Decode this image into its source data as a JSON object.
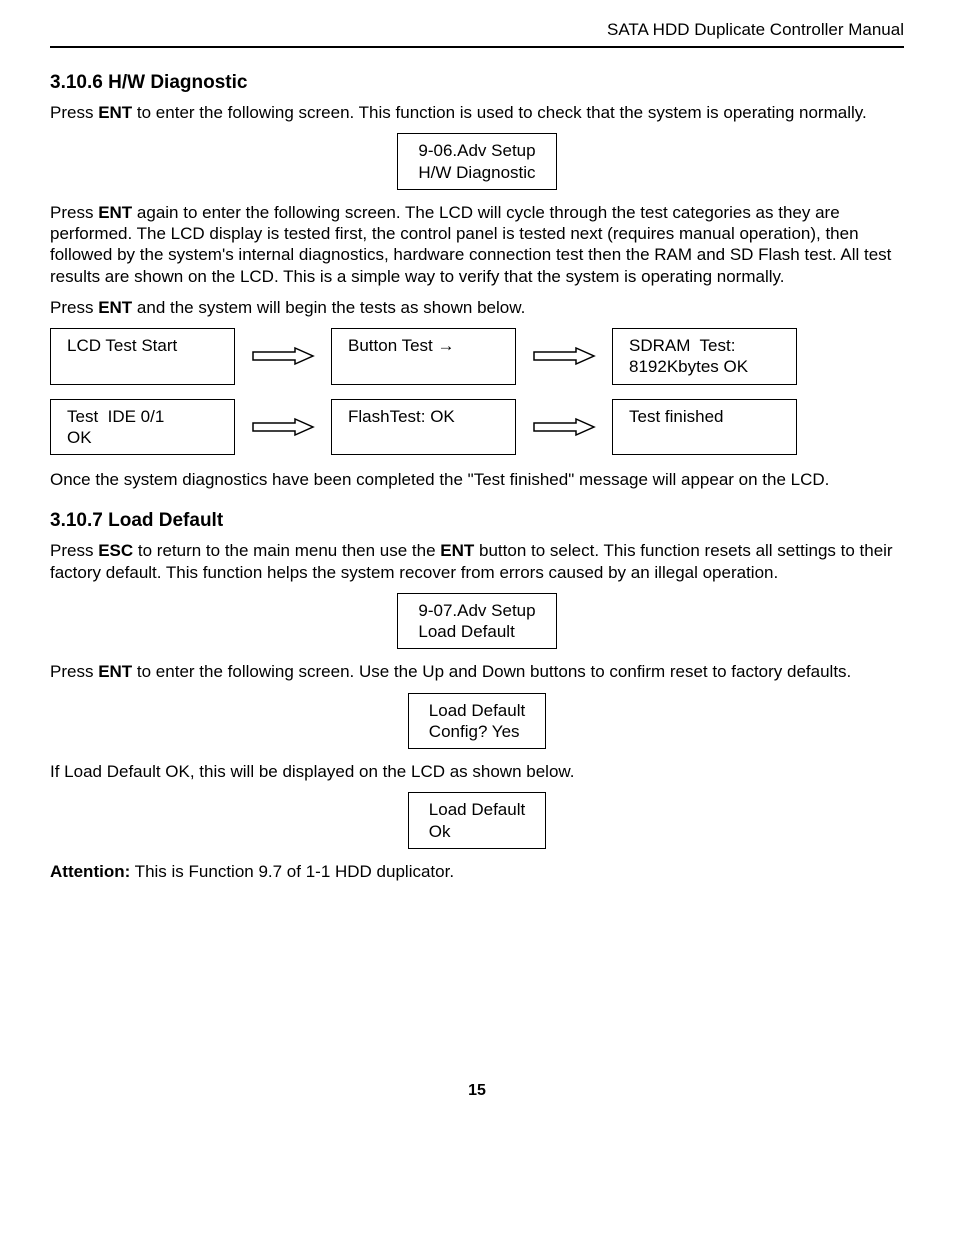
{
  "header": "SATA HDD Duplicate Controller Manual",
  "s1": {
    "heading": "3.10.6 H/W Diagnostic",
    "p1a": "Press ",
    "p1b": "ENT",
    "p1c": " to enter the following screen. This function is used to check that the system is operating normally.",
    "lcd1": {
      "l1": "9-06.Adv Setup",
      "l2": "H/W Diagnostic"
    },
    "p2a": "Press ",
    "p2b": "ENT",
    "p2c": " again to enter the following screen. The LCD will cycle through the test categories as they are performed. The LCD display is tested first, the control panel is tested next (requires manual operation), then followed by the system's internal diagnostics, hardware connection test then the RAM and SD Flash test. All test results are shown on the LCD. This is a simple way to verify that the system is operating normally.",
    "p3a": "Press ",
    "p3b": "ENT",
    "p3c": " and the system will begin the tests as shown below.",
    "flow": [
      {
        "l1": "LCD Test Start",
        "l2": ""
      },
      {
        "l1": "Button Test →",
        "l2": ""
      },
      {
        "l1": "SDRAM  Test:",
        "l2": "8192Kbytes OK"
      },
      {
        "l1": "Test  IDE 0/1",
        "l2": "OK"
      },
      {
        "l1": "FlashTest: OK",
        "l2": ""
      },
      {
        "l1": "Test finished",
        "l2": ""
      }
    ],
    "p4": "Once the system diagnostics have been completed the \"Test finished\" message will appear on the LCD."
  },
  "s2": {
    "heading": "3.10.7 Load Default",
    "p1a": "Press ",
    "p1b": "ESC",
    "p1c": " to return to the main menu then use the ",
    "p1d": "ENT",
    "p1e": " button to select. This function resets all settings to their factory default. This function helps the system recover from errors caused by an illegal operation.",
    "lcd1": {
      "l1": "9-07.Adv Setup",
      "l2": "Load Default"
    },
    "p2a": "Press ",
    "p2b": "ENT",
    "p2c": " to enter the following screen. Use the Up and Down buttons to confirm reset to factory defaults.",
    "lcd2": {
      "l1": "Load Default",
      "l2": "Config? Yes"
    },
    "p3": "If Load Default OK, this will be displayed on the LCD as shown below.",
    "lcd3": {
      "l1": "Load Default",
      "l2": "Ok"
    },
    "p4a": "Attention:",
    "p4b": " This is Function 9.7 of 1-1 HDD duplicator."
  },
  "page_number": "15"
}
